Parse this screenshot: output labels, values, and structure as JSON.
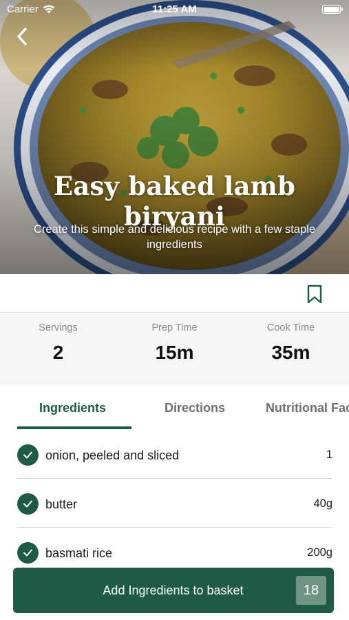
{
  "status_bar": {
    "carrier": "Carrier",
    "time": "11:25 AM"
  },
  "recipe": {
    "title": "Easy baked lamb biryani",
    "subtitle": "Create this simple and delicious recipe with a few staple ingredients"
  },
  "stats": [
    {
      "label": "Servings",
      "value": "2"
    },
    {
      "label": "Prep Time",
      "value": "15m"
    },
    {
      "label": "Cook Time",
      "value": "35m"
    }
  ],
  "tabs": [
    {
      "label": "Ingredients",
      "active": true
    },
    {
      "label": "Directions",
      "active": false
    },
    {
      "label": "Nutritional Facts",
      "active": false
    }
  ],
  "ingredients": [
    {
      "name": "onion, peeled and sliced",
      "quantity": "1",
      "checked": true
    },
    {
      "name": "butter",
      "quantity": "40g",
      "checked": true
    },
    {
      "name": "basmati rice",
      "quantity": "200g",
      "checked": true
    }
  ],
  "cta": {
    "label": "Add Ingredients to basket",
    "count": "18"
  },
  "colors": {
    "brand_green": "#1f5a47",
    "count_badge": "#6e9486",
    "muted_text": "#8a8a8a"
  },
  "icons": [
    "wifi-icon",
    "battery-icon",
    "back-chevron-icon",
    "bookmark-icon",
    "checkmark-icon"
  ]
}
